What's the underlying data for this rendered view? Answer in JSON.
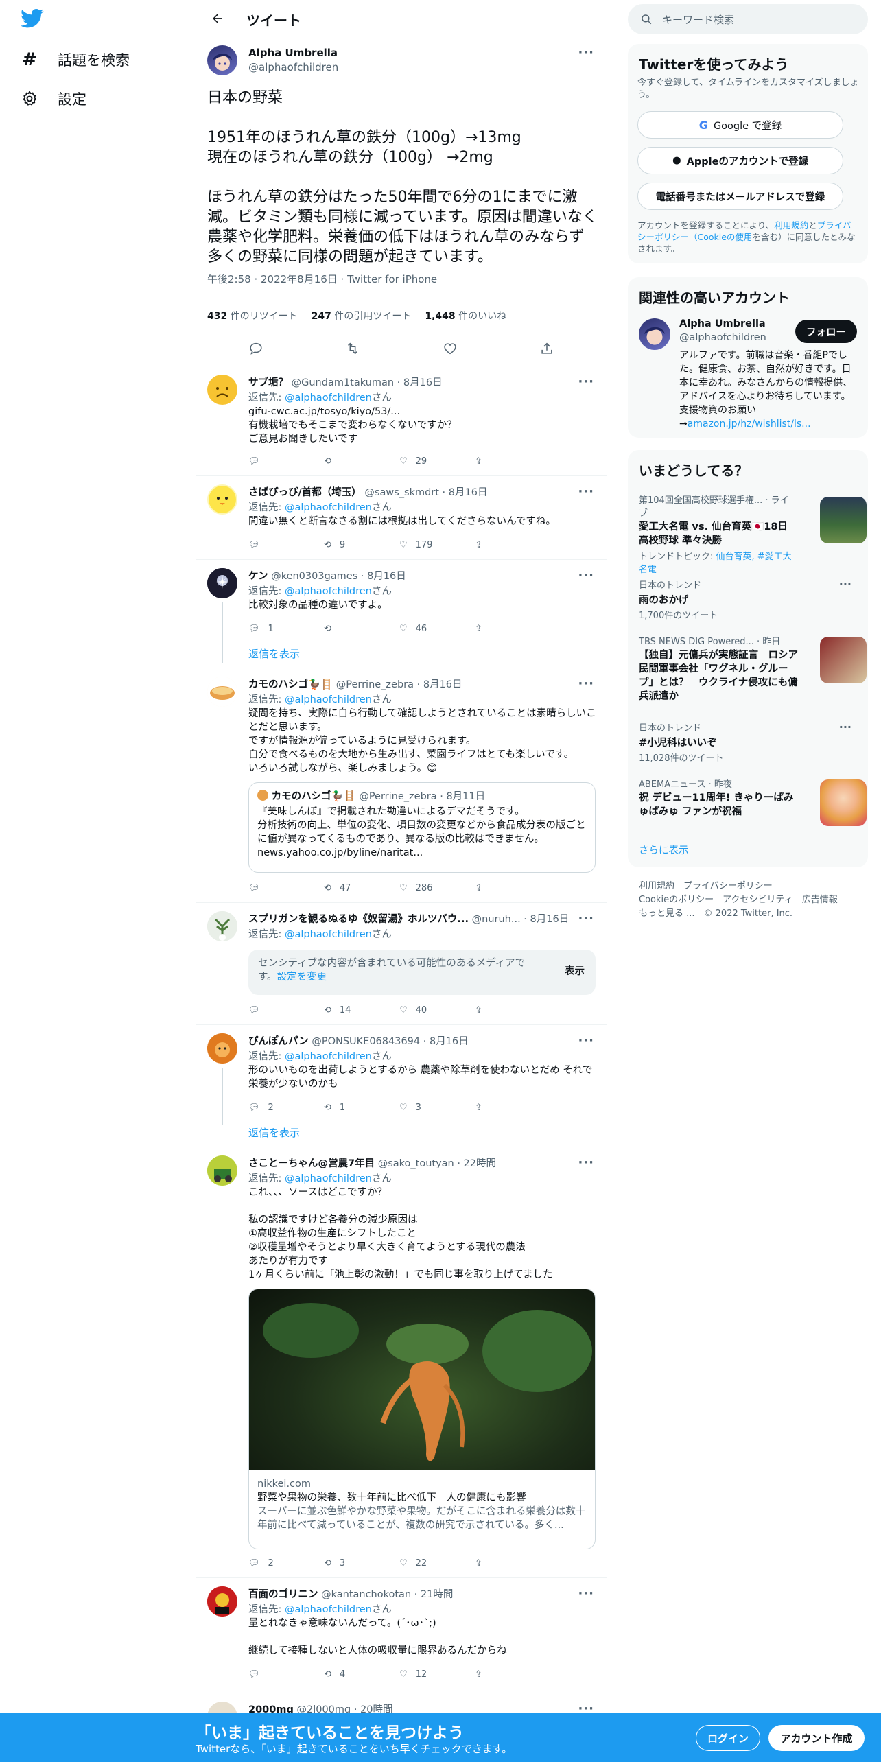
{
  "nav": {
    "explore": "話題を検索",
    "settings": "設定"
  },
  "header": {
    "title": "ツイート"
  },
  "focal": {
    "name": "Alpha Umbrella",
    "handle": "@alphaofchildren",
    "body": "日本の野菜\n\n1951年のほうれん草の鉄分（100g）→13mg\n現在のほうれん草の鉄分（100g） →2mg\n\nほうれん草の鉄分はたった50年間で6分の1にまでに激減。ビタミン類も同様に減っています。原因は間違いなく農薬や化学肥料。栄養価の低下はほうれん草のみならず多くの野菜に同様の問題が起きています。",
    "meta": "午後2:58 · 2022年8月16日 · Twitter for iPhone",
    "retweets_num": "432",
    "retweets_label": " 件のリツイート",
    "quotes_num": "247",
    "quotes_label": " 件の引用ツイート",
    "likes_num": "1,448",
    "likes_label": " 件のいいね"
  },
  "replies": [
    {
      "name": "サブ垢？",
      "handle": "@Gundam1takuman · 8月16日",
      "to_label": "返信先: ",
      "to_user": "@alphaofchildren",
      "to_suffix": "さん",
      "link": "gifu-cwc.ac.jp/tosyo/kiyo/53/...",
      "text": "有機栽培でもそこまで変わらなくないですか？\nご意見お聞きしたいです",
      "reply_count": "",
      "rt_count": "",
      "like_count": "29"
    },
    {
      "name": "さばぴっぴ/首都（埼玉）",
      "handle": "@saws_skmdrt · 8月16日",
      "to_label": "返信先: ",
      "to_user": "@alphaofchildren",
      "to_suffix": "さん",
      "text": "間違い無くと断言なさる割には根拠は出してくださらないんですね。",
      "reply_count": "",
      "rt_count": "9",
      "like_count": "179"
    },
    {
      "name": "ケン",
      "handle": "@ken0303games · 8月16日",
      "to_label": "返信先: ",
      "to_user": "@alphaofchildren",
      "to_suffix": "さん",
      "text": "比較対象の品種の違いですよ。",
      "reply_count": "1",
      "rt_count": "",
      "like_count": "46",
      "show_thread": "返信を表示"
    },
    {
      "name": "カモのハシゴ🦆🪜",
      "handle": "@Perrine_zebra · 8月16日",
      "to_label": "返信先: ",
      "to_user": "@alphaofchildren",
      "to_suffix": "さん",
      "text": "疑問を持ち、実際に自ら行動して確認しようとされていることは素晴らしいことだと思います。\nですが情報源が偏っているように見受けられます。\n自分で食べるものを大地から生み出す、菜園ライフはとても楽しいです。\nいろいろ試しながら、楽しみましょう。😊",
      "quote_name": "カモのハシゴ🦆🪜",
      "quote_handle": "@Perrine_zebra · 8月11日",
      "quote_text": "『美味しんぼ』で掲載された勘違いによるデマだそうです。\n分析技術の向上、単位の変化、項目数の変更などから食品成分表の版ごとに値が異なってくるものであり、異なる版の比較はできません。",
      "quote_link": "news.yahoo.co.jp/byline/naritat...",
      "reply_count": "",
      "rt_count": "47",
      "like_count": "286"
    },
    {
      "name": "スプリガンを観るぬるゆ《奴留湯》ホルツバウ...",
      "handle": "@nuruh... · 8月16日",
      "to_label": "返信先: ",
      "to_user": "@alphaofchildren",
      "to_suffix": "さん",
      "sensitive_text": "センシティブな内容が含まれている可能性のあるメディアです。",
      "sensitive_link": "設定を変更",
      "sensitive_button": "表示",
      "reply_count": "",
      "rt_count": "14",
      "like_count": "40"
    },
    {
      "name": "ぴんぽんパン",
      "handle": "@PONSUKE06843694 · 8月16日",
      "to_label": "返信先: ",
      "to_user": "@alphaofchildren",
      "to_suffix": "さん",
      "text": "形のいいものを出荷しようとするから 農薬や除草剤を使わないとだめ それで栄養が少ないのかも",
      "reply_count": "2",
      "rt_count": "1",
      "like_count": "3",
      "show_thread": "返信を表示"
    },
    {
      "name": "さことーちゃん@営農7年目",
      "handle": "@sako_toutyan · 22時間",
      "to_label": "返信先: ",
      "to_user": "@alphaofchildren",
      "to_suffix": "さん",
      "text": "これ、、、ソースはどこですか？\n\n私の認識ですけど各養分の減少原因は\n①高収益作物の生産にシフトしたこと\n②収穫量増やそうとより早く大きく育てようとする現代の農法\nあたりが有力です\n1ヶ月くらい前に「池上彰の激動！」でも同じ事を取り上げてました",
      "card_domain": "nikkei.com",
      "card_title": "野菜や果物の栄養、数十年前に比べ低下　人の健康にも影響",
      "card_desc": "スーパーに並ぶ色鮮やかな野菜や果物。だがそこに含まれる栄養分は数十年前に比べて減っていることが、複数の研究で示されている。多く...",
      "reply_count": "2",
      "rt_count": "3",
      "like_count": "22"
    },
    {
      "name": "百面のゴリニン",
      "handle": "@kantanchokotan · 21時間",
      "to_label": "返信先: ",
      "to_user": "@alphaofchildren",
      "to_suffix": "さん",
      "text": "量とれなきゃ意味ないんだって。(´･ω･`;)\n\n継続して接種しないと人体の吸収量に限界あるんだからね",
      "reply_count": "",
      "rt_count": "4",
      "like_count": "12"
    },
    {
      "name": "2000mg",
      "handle": "@2l000mg · 20時間"
    }
  ],
  "search": {
    "placeholder": "キーワード検索"
  },
  "signup": {
    "title": "Twitterを使ってみよう",
    "desc": "今すぐ登録して、タイムラインをカスタマイズしましょう。",
    "google": "Google で登録",
    "apple": "Appleのアカウントで登録",
    "phone": "電話番号またはメールアドレスで登録",
    "terms_pre": "アカウントを登録することにより、",
    "terms_link1": "利用規約",
    "terms_mid": "と",
    "terms_link2": "プライバシーポリシー（Cookieの使用",
    "terms_post": "を含む）に同意したとみなされます。"
  },
  "relevant": {
    "title": "関連性の高いアカウント",
    "name": "Alpha Umbrella",
    "handle": "@alphaofchildren",
    "follow": "フォロー",
    "bio": "アルファです。前職は音楽・番組Pでした。健康食、お茶、自然が好きです。日本に幸あれ。みなさんからの情報提供、アドバイスを心よりお待ちしています。支援物資のお願い→",
    "bio_link": "amazon.jp/hz/wishlist/ls..."
  },
  "trends": {
    "title": "いまどうしてる？",
    "items": [
      {
        "meta": "第104回全国高校野球選手権... · ライブ",
        "title": "愛工大名電 vs. 仙台育英🇯🇵18日 高校野球 準々決勝",
        "sub_pre": "トレンドトピック: ",
        "sub_links": "仙台育英, #愛工大名電"
      },
      {
        "meta": "日本のトレンド",
        "title": "雨のおかげ",
        "sub": "1,700件のツイート"
      },
      {
        "meta": "TBS NEWS DIG Powered... · 昨日",
        "title": "【独自】元傭兵が実態証言　ロシア民間軍事会社「ワグネル・グループ」とは？　ウクライナ侵攻にも傭兵派遣か"
      },
      {
        "meta": "日本のトレンド",
        "title": "#小児科はいいぞ",
        "sub": "11,028件のツイート"
      },
      {
        "meta": "ABEMAニュース · 昨夜",
        "title": "祝 デビュー11周年! きゃりーぱみゅぱみゅ ファンが祝福"
      }
    ],
    "show_more": "さらに表示"
  },
  "footer": {
    "l1": "利用規約　プライバシーポリシー",
    "l2": "Cookieのポリシー　アクセシビリティ　広告情報",
    "l3": "もっと見る ...　© 2022 Twitter, Inc."
  },
  "bottom": {
    "title": "「いま」起きていることを見つけよう",
    "sub": "Twitterなら、「いま」起きていることをいち早くチェックできます。",
    "login": "ログイン",
    "signup": "アカウント作成"
  },
  "colors": {
    "accent": "#1d9bf0",
    "text": "#0f1419",
    "muted": "#536471"
  }
}
